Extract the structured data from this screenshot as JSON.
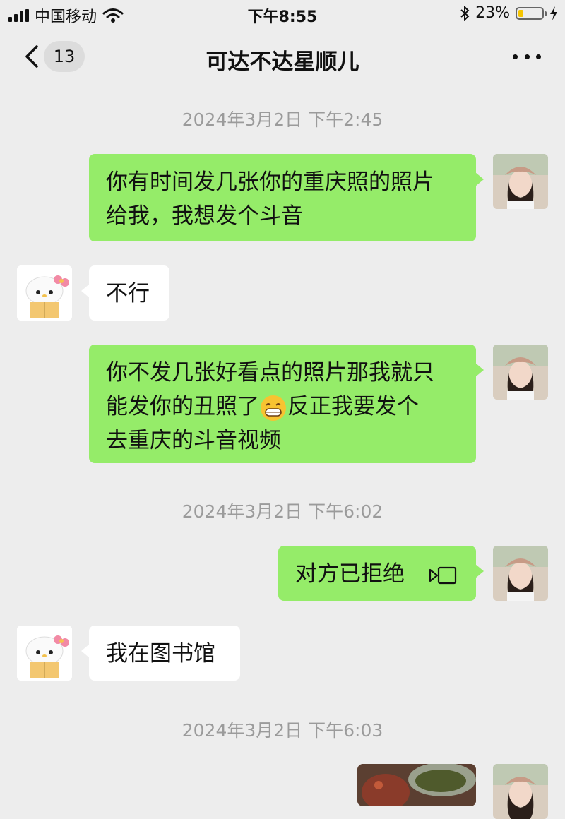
{
  "status_bar": {
    "carrier": "中国移动",
    "time": "下午8:55",
    "battery_percent": "23%",
    "battery_level": 0.23,
    "icons": [
      "signal-icon",
      "wifi-icon",
      "bluetooth-icon",
      "battery-icon",
      "charging-icon"
    ]
  },
  "nav": {
    "unread_count": "13",
    "title": "可达不达星顺儿",
    "icons": [
      "back-chevron-icon",
      "more-icon"
    ]
  },
  "messages": {
    "ts1": "2024年3月2日 下午2:45",
    "m1_line1": "你有时间发几张你的重庆照的照片",
    "m1_line2": "给我，我想发个斗音",
    "m2": "不行",
    "m3_line1": "你不发几张好看点的照片那我就只",
    "m3_line2_a": "能发你的丑照了",
    "m3_line2_b": "反正我要发个",
    "m3_line3": "去重庆的斗音视频",
    "ts2": "2024年3月2日 下午6:02",
    "m4": "对方已拒绝",
    "m5": "我在图书馆",
    "ts3": "2024年3月2日 下午6:03"
  },
  "colors": {
    "background": "#ededed",
    "outgoing_bubble": "#95ec69",
    "incoming_bubble": "#ffffff",
    "timestamp": "#9b9b9b"
  }
}
